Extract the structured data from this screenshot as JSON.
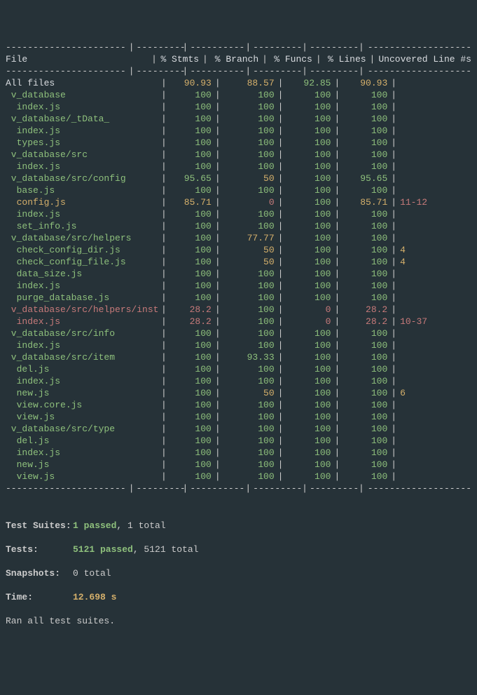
{
  "header": {
    "file": "File",
    "stmts": "% Stmts",
    "branch": "% Branch",
    "funcs": "% Funcs",
    "lines": "% Lines",
    "uncov": "Uncovered Line #s"
  },
  "dash_segments": [
    "---------------------------",
    "---------",
    "----------",
    "---------",
    "---------",
    "-------------------"
  ],
  "rows": [
    {
      "file": "All files",
      "indent": 0,
      "stmts": "90.93",
      "branch": "88.57",
      "funcs": "92.85",
      "lines": "90.93",
      "uncov": "",
      "c_file": "white",
      "c_stmts": "yellow",
      "c_branch": "yellow",
      "c_funcs": "green",
      "c_lines": "yellow",
      "c_uncov": "gray"
    },
    {
      "file": "v_database",
      "indent": 1,
      "stmts": "100",
      "branch": "100",
      "funcs": "100",
      "lines": "100",
      "uncov": "",
      "c_file": "green",
      "c_stmts": "green",
      "c_branch": "green",
      "c_funcs": "green",
      "c_lines": "green",
      "c_uncov": "gray"
    },
    {
      "file": "index.js",
      "indent": 2,
      "stmts": "100",
      "branch": "100",
      "funcs": "100",
      "lines": "100",
      "uncov": "",
      "c_file": "green",
      "c_stmts": "green",
      "c_branch": "green",
      "c_funcs": "green",
      "c_lines": "green",
      "c_uncov": "gray"
    },
    {
      "file": "v_database/_tData_",
      "indent": 1,
      "stmts": "100",
      "branch": "100",
      "funcs": "100",
      "lines": "100",
      "uncov": "",
      "c_file": "green",
      "c_stmts": "green",
      "c_branch": "green",
      "c_funcs": "green",
      "c_lines": "green",
      "c_uncov": "gray"
    },
    {
      "file": "index.js",
      "indent": 2,
      "stmts": "100",
      "branch": "100",
      "funcs": "100",
      "lines": "100",
      "uncov": "",
      "c_file": "green",
      "c_stmts": "green",
      "c_branch": "green",
      "c_funcs": "green",
      "c_lines": "green",
      "c_uncov": "gray"
    },
    {
      "file": "types.js",
      "indent": 2,
      "stmts": "100",
      "branch": "100",
      "funcs": "100",
      "lines": "100",
      "uncov": "",
      "c_file": "green",
      "c_stmts": "green",
      "c_branch": "green",
      "c_funcs": "green",
      "c_lines": "green",
      "c_uncov": "gray"
    },
    {
      "file": "v_database/src",
      "indent": 1,
      "stmts": "100",
      "branch": "100",
      "funcs": "100",
      "lines": "100",
      "uncov": "",
      "c_file": "green",
      "c_stmts": "green",
      "c_branch": "green",
      "c_funcs": "green",
      "c_lines": "green",
      "c_uncov": "gray"
    },
    {
      "file": "index.js",
      "indent": 2,
      "stmts": "100",
      "branch": "100",
      "funcs": "100",
      "lines": "100",
      "uncov": "",
      "c_file": "green",
      "c_stmts": "green",
      "c_branch": "green",
      "c_funcs": "green",
      "c_lines": "green",
      "c_uncov": "gray"
    },
    {
      "file": "v_database/src/config",
      "indent": 1,
      "stmts": "95.65",
      "branch": "50",
      "funcs": "100",
      "lines": "95.65",
      "uncov": "",
      "c_file": "green",
      "c_stmts": "green",
      "c_branch": "yellow",
      "c_funcs": "green",
      "c_lines": "green",
      "c_uncov": "gray"
    },
    {
      "file": "base.js",
      "indent": 2,
      "stmts": "100",
      "branch": "100",
      "funcs": "100",
      "lines": "100",
      "uncov": "",
      "c_file": "green",
      "c_stmts": "green",
      "c_branch": "green",
      "c_funcs": "green",
      "c_lines": "green",
      "c_uncov": "gray"
    },
    {
      "file": "config.js",
      "indent": 2,
      "stmts": "85.71",
      "branch": "0",
      "funcs": "100",
      "lines": "85.71",
      "uncov": "11-12",
      "c_file": "yellow",
      "c_stmts": "yellow",
      "c_branch": "red",
      "c_funcs": "green",
      "c_lines": "yellow",
      "c_uncov": "red"
    },
    {
      "file": "index.js",
      "indent": 2,
      "stmts": "100",
      "branch": "100",
      "funcs": "100",
      "lines": "100",
      "uncov": "",
      "c_file": "green",
      "c_stmts": "green",
      "c_branch": "green",
      "c_funcs": "green",
      "c_lines": "green",
      "c_uncov": "gray"
    },
    {
      "file": "set_info.js",
      "indent": 2,
      "stmts": "100",
      "branch": "100",
      "funcs": "100",
      "lines": "100",
      "uncov": "",
      "c_file": "green",
      "c_stmts": "green",
      "c_branch": "green",
      "c_funcs": "green",
      "c_lines": "green",
      "c_uncov": "gray"
    },
    {
      "file": "v_database/src/helpers",
      "indent": 1,
      "stmts": "100",
      "branch": "77.77",
      "funcs": "100",
      "lines": "100",
      "uncov": "",
      "c_file": "green",
      "c_stmts": "green",
      "c_branch": "yellow",
      "c_funcs": "green",
      "c_lines": "green",
      "c_uncov": "gray"
    },
    {
      "file": "check_config_dir.js",
      "indent": 2,
      "stmts": "100",
      "branch": "50",
      "funcs": "100",
      "lines": "100",
      "uncov": "4",
      "c_file": "green",
      "c_stmts": "green",
      "c_branch": "yellow",
      "c_funcs": "green",
      "c_lines": "green",
      "c_uncov": "yellow"
    },
    {
      "file": "check_config_file.js",
      "indent": 2,
      "stmts": "100",
      "branch": "50",
      "funcs": "100",
      "lines": "100",
      "uncov": "4",
      "c_file": "green",
      "c_stmts": "green",
      "c_branch": "yellow",
      "c_funcs": "green",
      "c_lines": "green",
      "c_uncov": "yellow"
    },
    {
      "file": "data_size.js",
      "indent": 2,
      "stmts": "100",
      "branch": "100",
      "funcs": "100",
      "lines": "100",
      "uncov": "",
      "c_file": "green",
      "c_stmts": "green",
      "c_branch": "green",
      "c_funcs": "green",
      "c_lines": "green",
      "c_uncov": "gray"
    },
    {
      "file": "index.js",
      "indent": 2,
      "stmts": "100",
      "branch": "100",
      "funcs": "100",
      "lines": "100",
      "uncov": "",
      "c_file": "green",
      "c_stmts": "green",
      "c_branch": "green",
      "c_funcs": "green",
      "c_lines": "green",
      "c_uncov": "gray"
    },
    {
      "file": "purge_database.js",
      "indent": 2,
      "stmts": "100",
      "branch": "100",
      "funcs": "100",
      "lines": "100",
      "uncov": "",
      "c_file": "green",
      "c_stmts": "green",
      "c_branch": "green",
      "c_funcs": "green",
      "c_lines": "green",
      "c_uncov": "gray"
    },
    {
      "file": "v_database/src/helpers/install",
      "indent": 1,
      "stmts": "28.2",
      "branch": "100",
      "funcs": "0",
      "lines": "28.2",
      "uncov": "",
      "c_file": "red",
      "c_stmts": "red",
      "c_branch": "green",
      "c_funcs": "red",
      "c_lines": "red",
      "c_uncov": "gray"
    },
    {
      "file": "index.js",
      "indent": 2,
      "stmts": "28.2",
      "branch": "100",
      "funcs": "0",
      "lines": "28.2",
      "uncov": "10-37",
      "c_file": "red",
      "c_stmts": "red",
      "c_branch": "green",
      "c_funcs": "red",
      "c_lines": "red",
      "c_uncov": "red"
    },
    {
      "file": "v_database/src/info",
      "indent": 1,
      "stmts": "100",
      "branch": "100",
      "funcs": "100",
      "lines": "100",
      "uncov": "",
      "c_file": "green",
      "c_stmts": "green",
      "c_branch": "green",
      "c_funcs": "green",
      "c_lines": "green",
      "c_uncov": "gray"
    },
    {
      "file": "index.js",
      "indent": 2,
      "stmts": "100",
      "branch": "100",
      "funcs": "100",
      "lines": "100",
      "uncov": "",
      "c_file": "green",
      "c_stmts": "green",
      "c_branch": "green",
      "c_funcs": "green",
      "c_lines": "green",
      "c_uncov": "gray"
    },
    {
      "file": "v_database/src/item",
      "indent": 1,
      "stmts": "100",
      "branch": "93.33",
      "funcs": "100",
      "lines": "100",
      "uncov": "",
      "c_file": "green",
      "c_stmts": "green",
      "c_branch": "green",
      "c_funcs": "green",
      "c_lines": "green",
      "c_uncov": "gray"
    },
    {
      "file": "del.js",
      "indent": 2,
      "stmts": "100",
      "branch": "100",
      "funcs": "100",
      "lines": "100",
      "uncov": "",
      "c_file": "green",
      "c_stmts": "green",
      "c_branch": "green",
      "c_funcs": "green",
      "c_lines": "green",
      "c_uncov": "gray"
    },
    {
      "file": "index.js",
      "indent": 2,
      "stmts": "100",
      "branch": "100",
      "funcs": "100",
      "lines": "100",
      "uncov": "",
      "c_file": "green",
      "c_stmts": "green",
      "c_branch": "green",
      "c_funcs": "green",
      "c_lines": "green",
      "c_uncov": "gray"
    },
    {
      "file": "new.js",
      "indent": 2,
      "stmts": "100",
      "branch": "50",
      "funcs": "100",
      "lines": "100",
      "uncov": "6",
      "c_file": "green",
      "c_stmts": "green",
      "c_branch": "yellow",
      "c_funcs": "green",
      "c_lines": "green",
      "c_uncov": "yellow"
    },
    {
      "file": "view.core.js",
      "indent": 2,
      "stmts": "100",
      "branch": "100",
      "funcs": "100",
      "lines": "100",
      "uncov": "",
      "c_file": "green",
      "c_stmts": "green",
      "c_branch": "green",
      "c_funcs": "green",
      "c_lines": "green",
      "c_uncov": "gray"
    },
    {
      "file": "view.js",
      "indent": 2,
      "stmts": "100",
      "branch": "100",
      "funcs": "100",
      "lines": "100",
      "uncov": "",
      "c_file": "green",
      "c_stmts": "green",
      "c_branch": "green",
      "c_funcs": "green",
      "c_lines": "green",
      "c_uncov": "gray"
    },
    {
      "file": "v_database/src/type",
      "indent": 1,
      "stmts": "100",
      "branch": "100",
      "funcs": "100",
      "lines": "100",
      "uncov": "",
      "c_file": "green",
      "c_stmts": "green",
      "c_branch": "green",
      "c_funcs": "green",
      "c_lines": "green",
      "c_uncov": "gray"
    },
    {
      "file": "del.js",
      "indent": 2,
      "stmts": "100",
      "branch": "100",
      "funcs": "100",
      "lines": "100",
      "uncov": "",
      "c_file": "green",
      "c_stmts": "green",
      "c_branch": "green",
      "c_funcs": "green",
      "c_lines": "green",
      "c_uncov": "gray"
    },
    {
      "file": "index.js",
      "indent": 2,
      "stmts": "100",
      "branch": "100",
      "funcs": "100",
      "lines": "100",
      "uncov": "",
      "c_file": "green",
      "c_stmts": "green",
      "c_branch": "green",
      "c_funcs": "green",
      "c_lines": "green",
      "c_uncov": "gray"
    },
    {
      "file": "new.js",
      "indent": 2,
      "stmts": "100",
      "branch": "100",
      "funcs": "100",
      "lines": "100",
      "uncov": "",
      "c_file": "green",
      "c_stmts": "green",
      "c_branch": "green",
      "c_funcs": "green",
      "c_lines": "green",
      "c_uncov": "gray"
    },
    {
      "file": "view.js",
      "indent": 2,
      "stmts": "100",
      "branch": "100",
      "funcs": "100",
      "lines": "100",
      "uncov": "",
      "c_file": "green",
      "c_stmts": "green",
      "c_branch": "green",
      "c_funcs": "green",
      "c_lines": "green",
      "c_uncov": "gray"
    }
  ],
  "summary": {
    "suites_label": "Test Suites:",
    "suites_passed": "1 passed",
    "suites_total": ", 1 total",
    "tests_label": "Tests:",
    "tests_passed": "5121 passed",
    "tests_total": ", 5121 total",
    "snapshots_label": "Snapshots:",
    "snapshots_value": "0 total",
    "time_label": "Time:",
    "time_value": "12.698 s",
    "ran": "Ran all test suites."
  }
}
